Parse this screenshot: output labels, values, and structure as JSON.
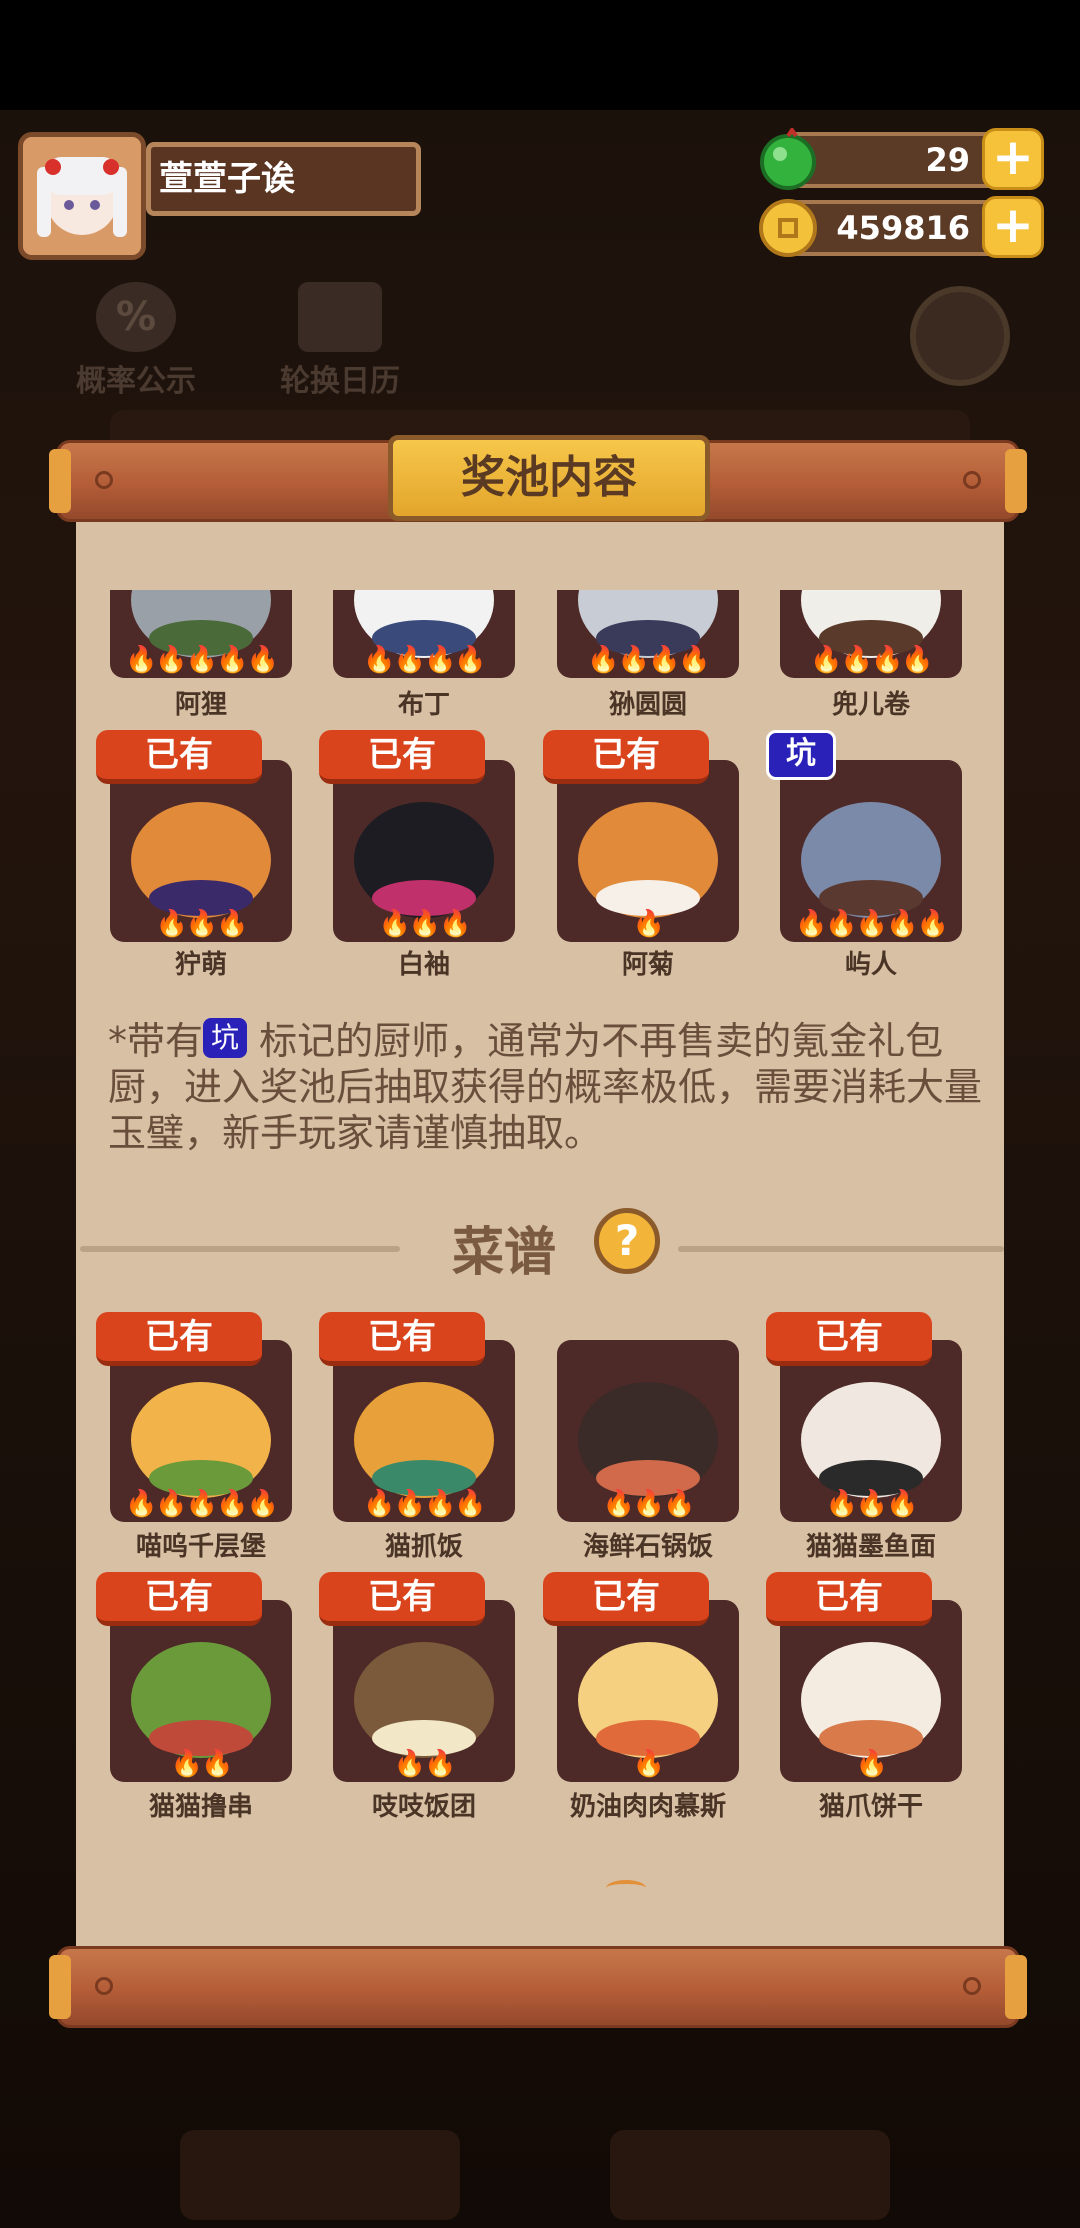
{
  "player": {
    "name": "萱萱子诶"
  },
  "resources": {
    "gem_count": "29",
    "coin_count": "459816"
  },
  "top_buttons": {
    "probability": "概率公示",
    "rotation": "轮换日历"
  },
  "panel": {
    "title": "奖池内容"
  },
  "chefs_top": [
    {
      "name": "阿狸",
      "flames": 5
    },
    {
      "name": "布丁",
      "flames": 4
    },
    {
      "name": "狲圆圆",
      "flames": 4
    },
    {
      "name": "兜儿卷",
      "flames": 4
    }
  ],
  "chefs_bottom": [
    {
      "name": "狞萌",
      "flames": 3,
      "badge": "已有"
    },
    {
      "name": "白袖",
      "flames": 3,
      "badge": "已有"
    },
    {
      "name": "阿菊",
      "flames": 1,
      "badge": "已有"
    },
    {
      "name": "屿人",
      "flames": 5,
      "badge": "坑"
    }
  ],
  "note": {
    "prefix": "*带有",
    "badge": "坑",
    "text": "标记的厨师，通常为不再售卖的氪金礼包厨，进入奖池后抽取获得的概率极低，需要消耗大量玉璧，新手玩家请谨慎抽取。"
  },
  "recipe_section": {
    "title": "菜谱",
    "help": "?"
  },
  "recipes_row1": [
    {
      "name": "喵呜千层堡",
      "flames": 5,
      "badge": "已有"
    },
    {
      "name": "猫抓饭",
      "flames": 4,
      "badge": "已有"
    },
    {
      "name": "海鲜石锅饭",
      "flames": 3,
      "badge": ""
    },
    {
      "name": "猫猫墨鱼面",
      "flames": 3,
      "badge": "已有"
    }
  ],
  "recipes_row2": [
    {
      "name": "猫猫撸串",
      "flames": 2,
      "badge": "已有"
    },
    {
      "name": "吱吱饭团",
      "flames": 2,
      "badge": "已有"
    },
    {
      "name": "奶油肉肉慕斯",
      "flames": 1,
      "badge": "已有"
    },
    {
      "name": "猫爪饼干",
      "flames": 1,
      "badge": "已有"
    }
  ],
  "flame_glyph": "🔥",
  "colors": {
    "owned_badge": "#d9441c",
    "pit_badge": "#2a22b8",
    "paper": "#d8c0a4",
    "card": "#4d2a28"
  }
}
